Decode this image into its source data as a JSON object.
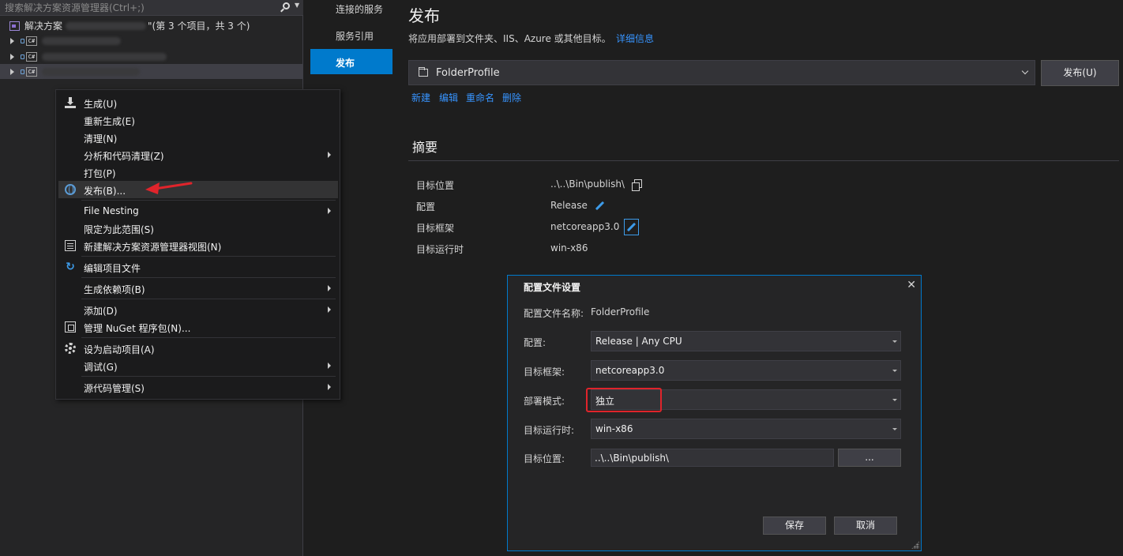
{
  "solution_explorer": {
    "search_placeholder": "搜索解决方案资源管理器(Ctrl+;)",
    "solution_label": "解决方案",
    "solution_count": "\"(第 3 个项目，共 3 个)",
    "project_icon_text": "C#"
  },
  "context_menu": {
    "items": [
      {
        "label": "生成(U)"
      },
      {
        "label": "重新生成(E)"
      },
      {
        "label": "清理(N)"
      },
      {
        "label": "分析和代码清理(Z)"
      },
      {
        "label": "打包(P)"
      },
      {
        "label": "发布(B)..."
      },
      {
        "label": "File Nesting"
      },
      {
        "label": "限定为此范围(S)"
      },
      {
        "label": "新建解决方案资源管理器视图(N)"
      },
      {
        "label": "编辑项目文件"
      },
      {
        "label": "生成依赖项(B)"
      },
      {
        "label": "添加(D)"
      },
      {
        "label": "管理 NuGet 程序包(N)..."
      },
      {
        "label": "设为启动项目(A)"
      },
      {
        "label": "调试(G)"
      },
      {
        "label": "源代码管理(S)"
      }
    ]
  },
  "left_nav": {
    "items": [
      {
        "label": "连接的服务"
      },
      {
        "label": "服务引用"
      },
      {
        "label": "发布",
        "active": true
      }
    ]
  },
  "publish": {
    "title": "发布",
    "description": "将应用部署到文件夹、IIS、Azure 或其他目标。",
    "more_info": "详细信息",
    "profile": "FolderProfile",
    "publish_button": "发布(U)",
    "actions": [
      "新建",
      "编辑",
      "重命名",
      "删除"
    ],
    "summary_title": "摘要",
    "summary": [
      {
        "label": "目标位置",
        "value": "..\\..\\Bin\\publish\\"
      },
      {
        "label": "配置",
        "value": "Release"
      },
      {
        "label": "目标框架",
        "value": "netcoreapp3.0"
      },
      {
        "label": "目标运行时",
        "value": "win-x86"
      }
    ]
  },
  "dialog": {
    "title": "配置文件设置",
    "close": "✕",
    "profile_name_label": "配置文件名称:",
    "profile_name": "FolderProfile",
    "config_label": "配置:",
    "config_value": "Release | Any CPU",
    "framework_label": "目标框架:",
    "framework_value": "netcoreapp3.0",
    "deploy_label": "部署模式:",
    "deploy_value": "独立",
    "runtime_label": "目标运行时:",
    "runtime_value": "win-x86",
    "location_label": "目标位置:",
    "location_value": "..\\..\\Bin\\publish\\",
    "browse_button": "...",
    "save_button": "保存",
    "cancel_button": "取消"
  },
  "colors": {
    "accent": "#007acc",
    "link": "#3794ff",
    "highlight": "#e0242b",
    "background": "#1e1e1e"
  },
  "icons": [
    "search-icon",
    "solution-icon",
    "csharp-project-icon",
    "build-icon",
    "globe-icon",
    "new-view-icon",
    "edit-icon",
    "nuget-icon",
    "gear-icon",
    "folder-icon",
    "copy-icon",
    "pencil-icon",
    "close-icon"
  ]
}
